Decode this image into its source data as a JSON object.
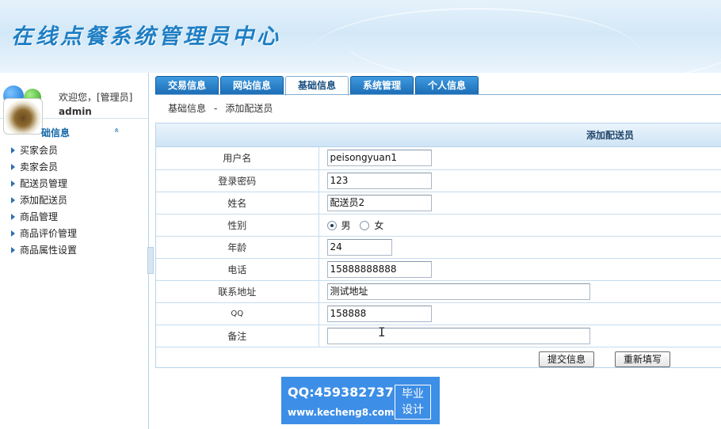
{
  "header": {
    "title": "在线点餐系统管理员中心"
  },
  "sidebar": {
    "welcome": "欢迎您，[管理员]",
    "username": "admin",
    "section_label": "础信息",
    "chevron": "«",
    "items": [
      {
        "label": "买家会员"
      },
      {
        "label": "卖家会员"
      },
      {
        "label": "配送员管理"
      },
      {
        "label": "添加配送员"
      },
      {
        "label": "商品管理"
      },
      {
        "label": "商品评价管理"
      },
      {
        "label": "商品属性设置"
      }
    ]
  },
  "tabs": [
    {
      "label": "交易信息"
    },
    {
      "label": "网站信息"
    },
    {
      "label": "基础信息",
      "active": true
    },
    {
      "label": "系统管理"
    },
    {
      "label": "个人信息"
    }
  ],
  "breadcrumb": {
    "parent": "基础信息",
    "separator": "-",
    "current": "添加配送员"
  },
  "form": {
    "title": "添加配送员",
    "fields": {
      "username": {
        "label": "用户名",
        "value": "peisongyuan1"
      },
      "password": {
        "label": "登录密码",
        "value": "123"
      },
      "name": {
        "label": "姓名",
        "value": "配送员2"
      },
      "gender": {
        "label": "性别",
        "option_male": "男",
        "option_female": "女",
        "selected": "男"
      },
      "age": {
        "label": "年龄",
        "value": "24"
      },
      "phone": {
        "label": "电话",
        "value": "15888888888"
      },
      "address": {
        "label": "联系地址",
        "value": "测试地址"
      },
      "qq": {
        "label": "QQ",
        "value": "158888"
      },
      "remark": {
        "label": "备注",
        "value": ""
      }
    },
    "submit_label": "提交信息",
    "reset_label": "重新填写"
  },
  "watermark": {
    "qq": "QQ:459382737",
    "site": "www.kecheng8.com",
    "badge_line1": "毕业",
    "badge_line2": "设计"
  },
  "colors": {
    "accent": "#1b6cb4",
    "header_title": "#1f7fc4",
    "watermark_bg": "#3d8ee6"
  }
}
